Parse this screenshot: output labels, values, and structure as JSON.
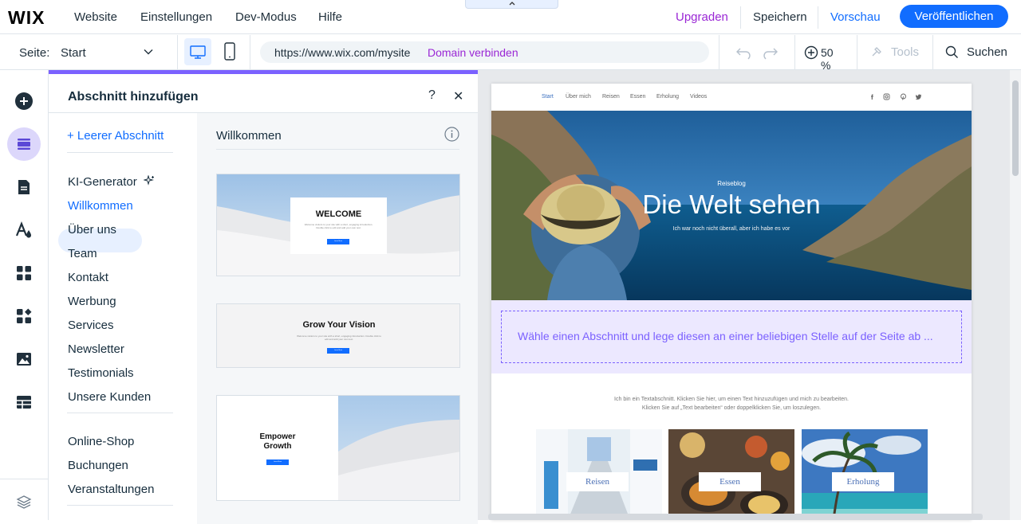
{
  "topbar": {
    "logo": "WIX",
    "menu": [
      "Website",
      "Einstellungen",
      "Dev-Modus",
      "Hilfe"
    ],
    "upgrade": "Upgraden",
    "save": "Speichern",
    "preview": "Vorschau",
    "publish": "Veröffentlichen",
    "collapse_icon": "chevron-up-icon",
    "colors": {
      "accent": "#116dff",
      "upgrade": "#9a27d5"
    }
  },
  "secondbar": {
    "page_label": "Seite:",
    "page_value": "Start",
    "url": "https://www.wix.com/mysite",
    "domain_link": "Domain verbinden",
    "zoom": "50 %",
    "tools": "Tools",
    "search": "Suchen"
  },
  "panel": {
    "title": "Abschnitt hinzufügen",
    "help": "?",
    "close": "✕",
    "blank_section": "+ Leerer Abschnitt",
    "nav_group1": [
      "KI-Generator",
      "Willkommen",
      "Über uns",
      "Team",
      "Kontakt",
      "Werbung",
      "Services",
      "Newsletter",
      "Testimonials",
      "Unsere Kunden"
    ],
    "nav_group2": [
      "Online-Shop",
      "Buchungen",
      "Veranstaltungen"
    ],
    "active_nav": "Willkommen",
    "list_title": "Willkommen",
    "cards": [
      {
        "heading": "WELCOME",
        "body": "Welcome visitors to your site with a short, engaging introduction. Double click to edit and add your own text.",
        "button": "Learn More"
      },
      {
        "heading": "Grow Your Vision",
        "body": "Welcome visitors to your site with a short, engaging introduction. Double click to edit and add your own text.",
        "button": "Learn More"
      },
      {
        "heading": "Empower Growth",
        "button": "Learn More"
      }
    ]
  },
  "site": {
    "nav": [
      "Start",
      "Über mich",
      "Reisen",
      "Essen",
      "Erholung",
      "Videos"
    ],
    "hero_kicker": "Reiseblog",
    "hero_title": "Die Welt sehen",
    "hero_subtitle": "Ich war noch nicht überall, aber ich habe es vor",
    "drop_hint": "Wähle einen Abschnitt und lege diesen an einer beliebigen Stelle auf der Seite ab ...",
    "body_line1": "Ich bin ein Textabschnitt. Klicken Sie hier, um einen Text hinzuzufügen und mich zu bearbeiten.",
    "body_line2": "Klicken Sie auf „Text bearbeiten“ oder doppelklicken Sie, um loszulegen.",
    "thumbs": [
      "Reisen",
      "Essen",
      "Erholung"
    ]
  }
}
